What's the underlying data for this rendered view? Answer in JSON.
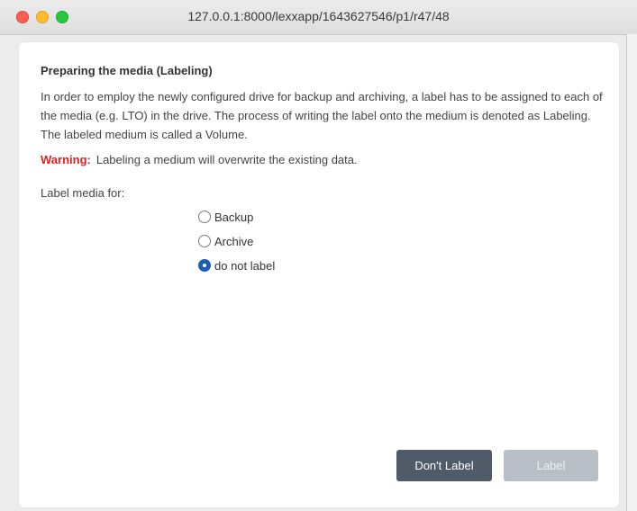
{
  "window": {
    "url": "127.0.0.1:8000/lexxapp/1643627546/p1/r47/48"
  },
  "dialog": {
    "title": "Preparing the media (Labeling)",
    "description": "In order to employ the newly configured drive for backup and archiving, a label has to be assigned to each of the media (e.g. LTO) in the drive. The process of writing the label onto the medium is denoted as Labeling. The labeled medium is called a Volume.",
    "warning_label": "Warning:",
    "warning_text": "Labeling a medium will overwrite the existing data.",
    "label_media_for": "Label media for:",
    "options": [
      {
        "label": "Backup",
        "selected": false
      },
      {
        "label": "Archive",
        "selected": false
      },
      {
        "label": "do not label",
        "selected": true
      }
    ],
    "buttons": {
      "dont_label": "Don't Label",
      "label": "Label"
    }
  },
  "colors": {
    "warning": "#e02020",
    "primary_button": "#4f5b68",
    "disabled_button": "#b9bfc6",
    "radio_selected": "#1a5fb4"
  }
}
